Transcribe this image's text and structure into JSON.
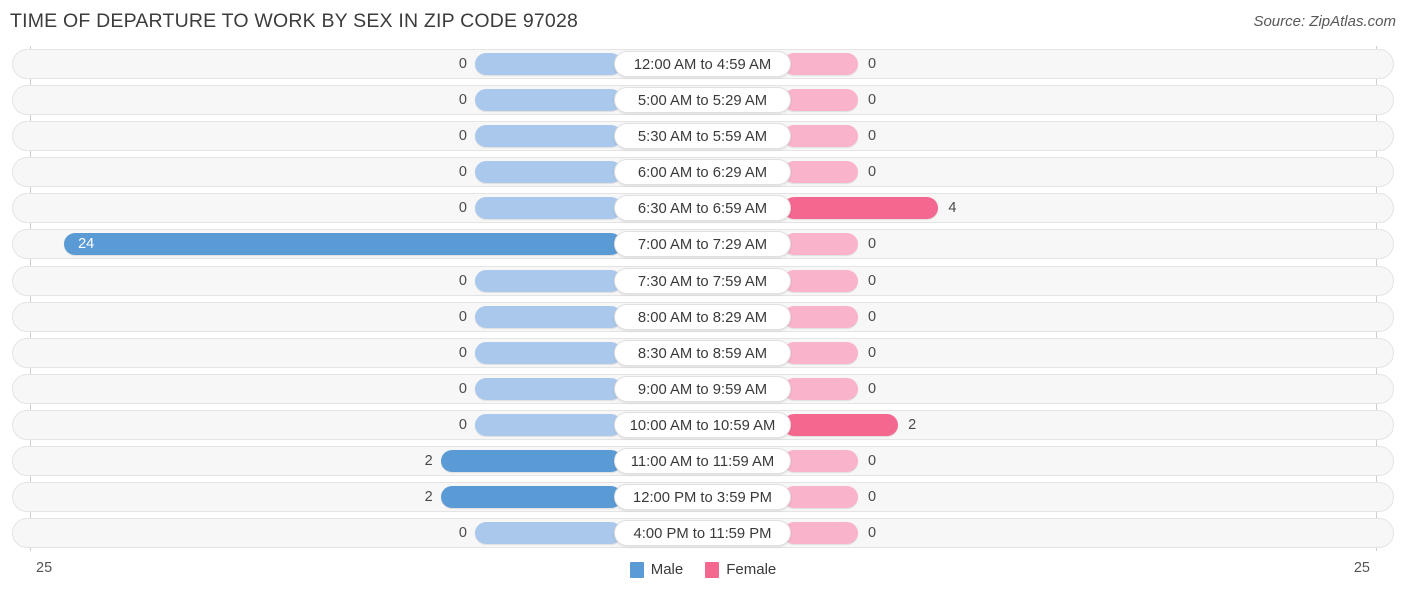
{
  "header": {
    "title": "TIME OF DEPARTURE TO WORK BY SEX IN ZIP CODE 97028",
    "source": "Source: ZipAtlas.com"
  },
  "legend": {
    "male_label": "Male",
    "female_label": "Female",
    "male_color": "#5b9bd5",
    "female_color": "#f4688f",
    "male_base_color": "#aac8ec",
    "female_base_color": "#f9b4cc"
  },
  "axis": {
    "left_tick": "25",
    "right_tick": "25",
    "max": 25
  },
  "chart_data": {
    "type": "bar",
    "subtype": "diverging-horizontal",
    "title": "TIME OF DEPARTURE TO WORK BY SEX IN ZIP CODE 97028",
    "xlabel": "",
    "ylabel": "",
    "xlim": [
      25,
      25
    ],
    "grid": false,
    "legend_position": "bottom-center",
    "categories": [
      "12:00 AM to 4:59 AM",
      "5:00 AM to 5:29 AM",
      "5:30 AM to 5:59 AM",
      "6:00 AM to 6:29 AM",
      "6:30 AM to 6:59 AM",
      "7:00 AM to 7:29 AM",
      "7:30 AM to 7:59 AM",
      "8:00 AM to 8:29 AM",
      "8:30 AM to 8:59 AM",
      "9:00 AM to 9:59 AM",
      "10:00 AM to 10:59 AM",
      "11:00 AM to 11:59 AM",
      "12:00 PM to 3:59 PM",
      "4:00 PM to 11:59 PM"
    ],
    "series": [
      {
        "name": "Male",
        "color": "#5b9bd5",
        "direction": "left",
        "values": [
          0,
          0,
          0,
          0,
          0,
          24,
          0,
          0,
          0,
          0,
          0,
          2,
          2,
          0
        ]
      },
      {
        "name": "Female",
        "color": "#f4688f",
        "direction": "right",
        "values": [
          0,
          0,
          0,
          0,
          4,
          0,
          0,
          0,
          0,
          0,
          2,
          0,
          0,
          0
        ]
      }
    ]
  },
  "rows": [
    {
      "category": "12:00 AM to 4:59 AM",
      "male": "0",
      "female": "0"
    },
    {
      "category": "5:00 AM to 5:29 AM",
      "male": "0",
      "female": "0"
    },
    {
      "category": "5:30 AM to 5:59 AM",
      "male": "0",
      "female": "0"
    },
    {
      "category": "6:00 AM to 6:29 AM",
      "male": "0",
      "female": "0"
    },
    {
      "category": "6:30 AM to 6:59 AM",
      "male": "0",
      "female": "4"
    },
    {
      "category": "7:00 AM to 7:29 AM",
      "male": "24",
      "female": "0"
    },
    {
      "category": "7:30 AM to 7:59 AM",
      "male": "0",
      "female": "0"
    },
    {
      "category": "8:00 AM to 8:29 AM",
      "male": "0",
      "female": "0"
    },
    {
      "category": "8:30 AM to 8:59 AM",
      "male": "0",
      "female": "0"
    },
    {
      "category": "9:00 AM to 9:59 AM",
      "male": "0",
      "female": "0"
    },
    {
      "category": "10:00 AM to 10:59 AM",
      "male": "0",
      "female": "2"
    },
    {
      "category": "11:00 AM to 11:59 AM",
      "male": "2",
      "female": "0"
    },
    {
      "category": "12:00 PM to 3:59 PM",
      "male": "2",
      "female": "0"
    },
    {
      "category": "4:00 PM to 11:59 PM",
      "male": "0",
      "female": "0"
    }
  ]
}
